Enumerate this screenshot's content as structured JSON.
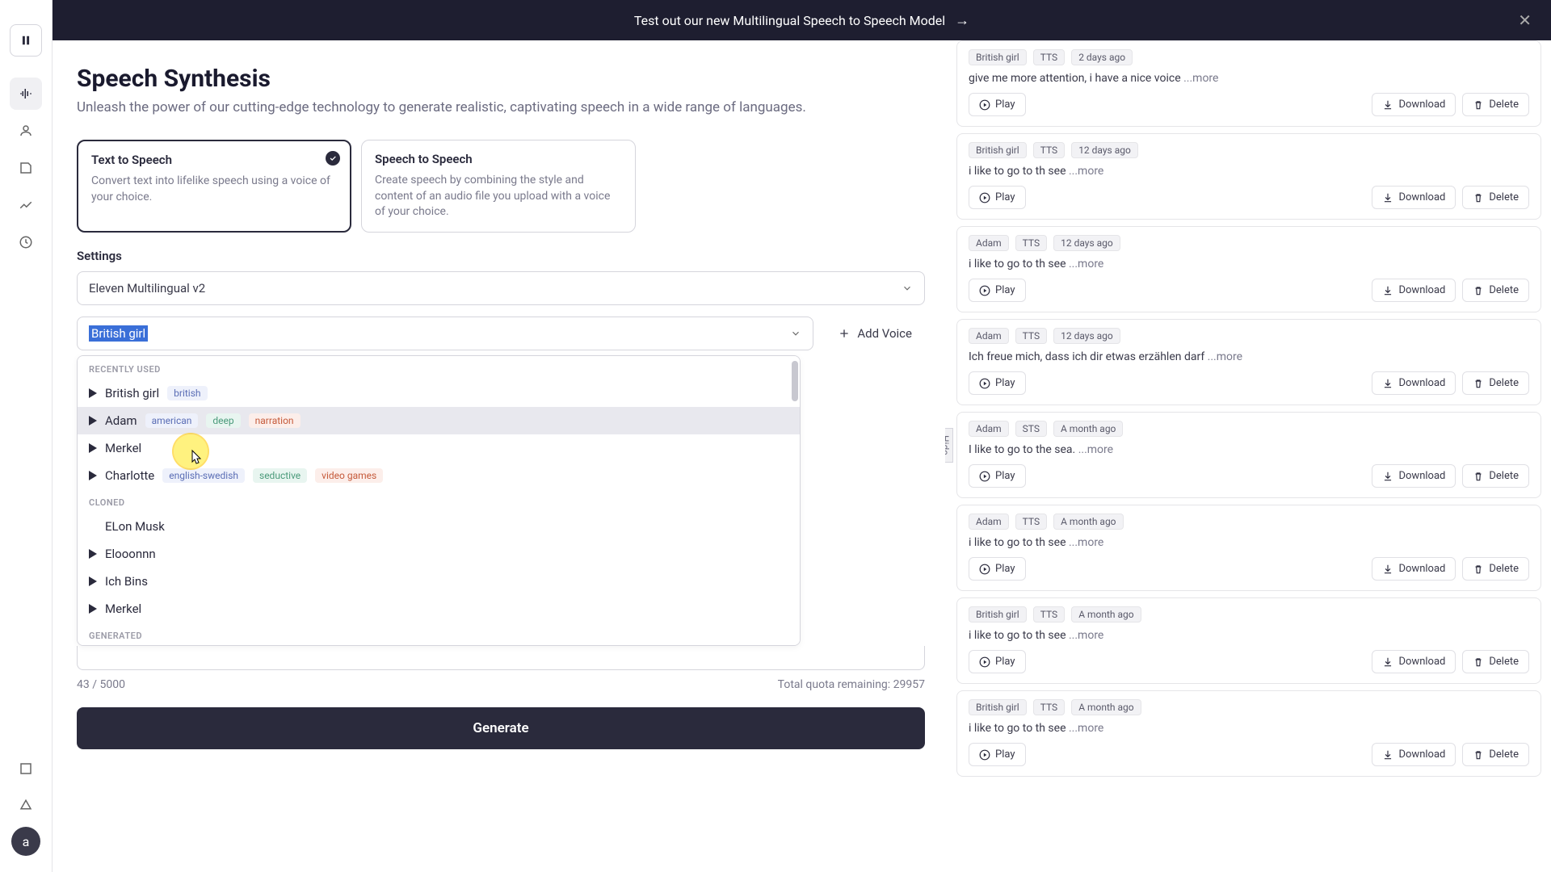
{
  "banner": {
    "text": "Test out our new Multilingual Speech to Speech Model"
  },
  "sidebar": {
    "avatar_initial": "a"
  },
  "page": {
    "title": "Speech Synthesis",
    "subtitle": "Unleash the power of our cutting-edge technology to generate realistic, captivating speech in a wide range of languages."
  },
  "modes": [
    {
      "title": "Text to Speech",
      "desc": "Convert text into lifelike speech using a voice of your choice.",
      "selected": true
    },
    {
      "title": "Speech to Speech",
      "desc": "Create speech by combining the style and content of an audio file you upload with a voice of your choice.",
      "selected": false
    }
  ],
  "settings": {
    "label": "Settings",
    "model": "Eleven Multilingual v2",
    "voice_selected": "British girl",
    "add_voice": "Add Voice"
  },
  "dropdown": {
    "sections": [
      {
        "header": "RECENTLY USED",
        "items": [
          {
            "name": "British girl",
            "tags": [
              "british"
            ],
            "play": true
          },
          {
            "name": "Adam",
            "tags": [
              "american",
              "deep",
              "narration"
            ],
            "play": true,
            "highlight": true
          },
          {
            "name": "Merkel",
            "tags": [],
            "play": true
          },
          {
            "name": "Charlotte",
            "tags": [
              "english-swedish",
              "seductive",
              "video games"
            ],
            "play": true
          }
        ]
      },
      {
        "header": "CLONED",
        "items": [
          {
            "name": "ELon Musk",
            "tags": [],
            "play": false
          },
          {
            "name": "Elooonnn",
            "tags": [],
            "play": true
          },
          {
            "name": "Ich Bins",
            "tags": [],
            "play": true
          },
          {
            "name": "Merkel",
            "tags": [],
            "play": true
          }
        ]
      },
      {
        "header": "GENERATED",
        "items": []
      }
    ]
  },
  "quota": {
    "count": "43 / 5000",
    "remaining": "Total quota remaining: 29957"
  },
  "generate": "Generate",
  "hide_label": "Hide",
  "history": [
    {
      "voice": "British girl",
      "mode": "TTS",
      "when": "2 days ago",
      "text": "give me more attention, i have a nice voice ",
      "more": "...more"
    },
    {
      "voice": "British girl",
      "mode": "TTS",
      "when": "12 days ago",
      "text": "i like to go to th see ",
      "more": "...more"
    },
    {
      "voice": "Adam",
      "mode": "TTS",
      "when": "12 days ago",
      "text": "i like to go to th see ",
      "more": "...more"
    },
    {
      "voice": "Adam",
      "mode": "TTS",
      "when": "12 days ago",
      "text": "Ich freue mich, dass ich dir etwas erzählen darf ",
      "more": "...more"
    },
    {
      "voice": "Adam",
      "mode": "STS",
      "when": "A month ago",
      "text": "I like to go to the sea. ",
      "more": "...more"
    },
    {
      "voice": "Adam",
      "mode": "TTS",
      "when": "A month ago",
      "text": "i like to go to th see ",
      "more": "...more"
    },
    {
      "voice": "British girl",
      "mode": "TTS",
      "when": "A month ago",
      "text": "i like to go to th see ",
      "more": "...more"
    },
    {
      "voice": "British girl",
      "mode": "TTS",
      "when": "A month ago",
      "text": "i like to go to th see ",
      "more": "...more"
    }
  ],
  "buttons": {
    "play": "Play",
    "download": "Download",
    "delete": "Delete"
  }
}
